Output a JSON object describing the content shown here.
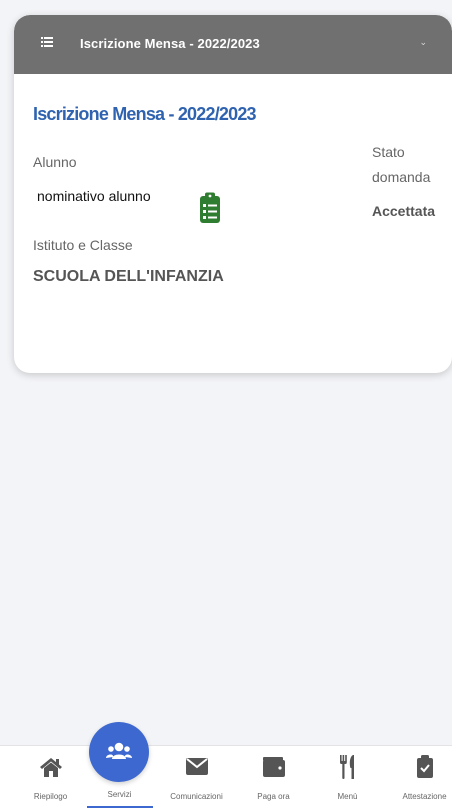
{
  "header": {
    "title": "Iscrizione Mensa - 2022/2023",
    "chevron": "⌄"
  },
  "card": {
    "title": "Iscrizione Mensa - 2022/2023",
    "student_label": "Alunno",
    "student_name": "nominativo alunno",
    "school_label": "Istituto e Classe",
    "school_name": "SCUOLA DELL'INFANZIA",
    "status_label": "Stato domanda",
    "status_value": "Accettata",
    "clipboard_icon": "clipboard-list-icon",
    "icon_color": "#2f7d31"
  },
  "nav": {
    "items": [
      {
        "label": "Riepilogo",
        "icon": "home-icon"
      },
      {
        "label": "Servizi",
        "icon": "users-icon"
      },
      {
        "label": "Comunicazioni",
        "icon": "envelope-icon"
      },
      {
        "label": "Paga ora",
        "icon": "wallet-icon"
      },
      {
        "label": "Menù",
        "icon": "utensils-icon"
      },
      {
        "label": "Attestazione",
        "icon": "clipboard-check-icon"
      }
    ],
    "active_index": 1,
    "accent_color": "#3c68cf"
  },
  "colors": {
    "header_bg": "#707070",
    "title_blue": "#2f63b0"
  }
}
